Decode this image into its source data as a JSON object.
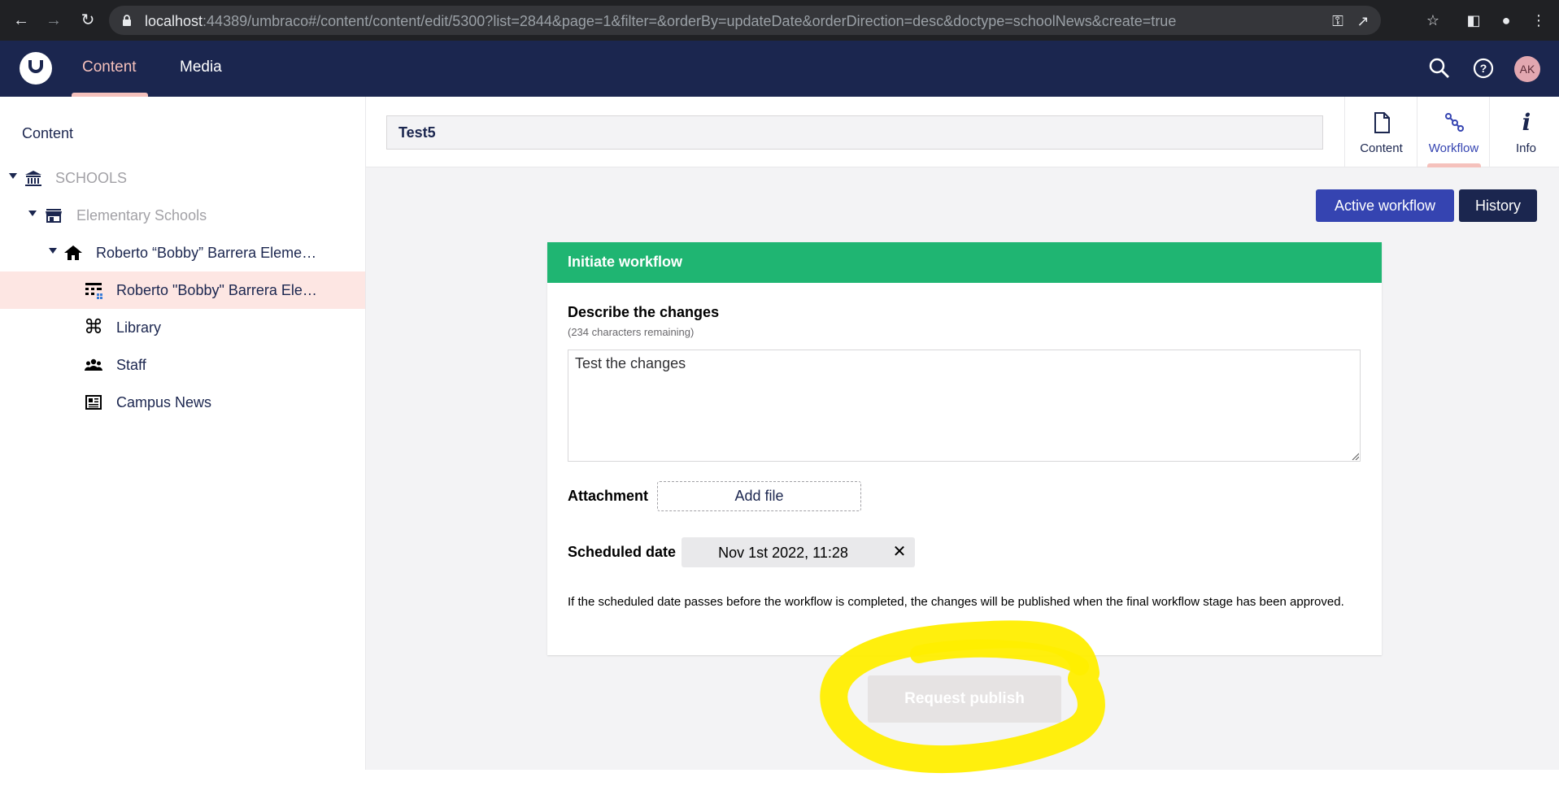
{
  "browser": {
    "url_host": "localhost",
    "url_rest": ":44389/umbraco#/content/content/edit/5300?list=2844&page=1&filter=&orderBy=updateDate&orderDirection=desc&doctype=schoolNews&create=true"
  },
  "header": {
    "sections": [
      {
        "label": "Content"
      },
      {
        "label": "Media"
      }
    ],
    "avatar_initials": "AK"
  },
  "sidebar": {
    "title": "Content",
    "items": [
      {
        "label": "SCHOOLS",
        "icon": "institution-icon"
      },
      {
        "label": "Elementary Schools",
        "icon": "store-icon"
      },
      {
        "label": "Roberto “Bobby” Barrera Eleme…",
        "icon": "home-icon"
      },
      {
        "label": "Roberto \"Bobby\" Barrera Ele…",
        "icon": "grid-icon"
      },
      {
        "label": "Library",
        "icon": "command-icon"
      },
      {
        "label": "Staff",
        "icon": "users-icon"
      },
      {
        "label": "Campus News",
        "icon": "newspaper-icon"
      }
    ]
  },
  "main": {
    "node_name": "Test5",
    "apps": [
      {
        "label": "Content",
        "icon": "document-icon"
      },
      {
        "label": "Workflow",
        "icon": "workflow-icon"
      },
      {
        "label": "Info",
        "icon": "info-icon"
      }
    ],
    "buttons": {
      "active_workflow": "Active workflow",
      "history": "History"
    },
    "form": {
      "title": "Initiate workflow",
      "describe_label": "Describe the changes",
      "chars_remaining": "(234 characters remaining)",
      "description_value": "Test the changes",
      "attachment_label": "Attachment",
      "add_file": "Add file",
      "scheduled_label": "Scheduled date",
      "scheduled_value": "Nov 1st 2022, 11:28",
      "clear_symbol": "✕",
      "note": "If the scheduled date passes before the workflow is completed, the changes will be published when the final workflow stage has been approved."
    },
    "request_publish": "Request publish"
  },
  "colors": {
    "header_bg": "#1b264f",
    "accent_pink": "#f5c1bc",
    "workflow_green": "#1fb572",
    "primary_blue": "#3544b1",
    "highlight_yellow": "#ffee00"
  }
}
